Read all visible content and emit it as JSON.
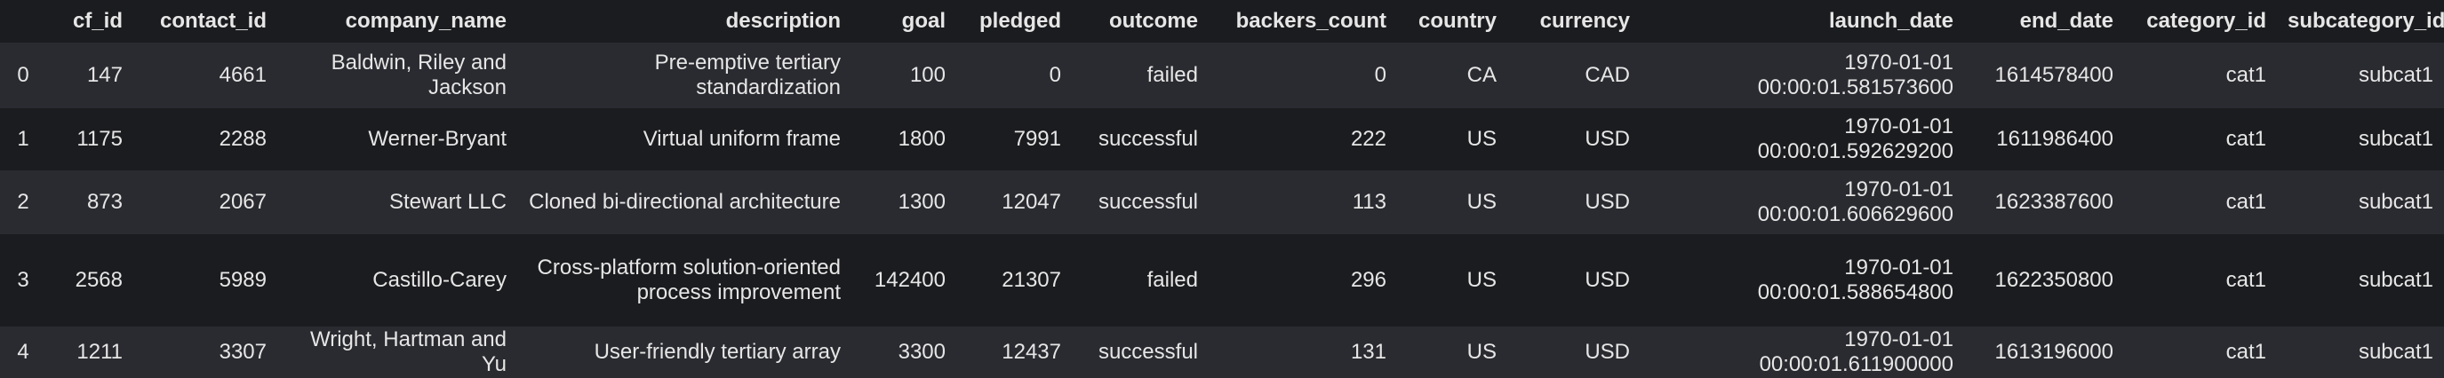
{
  "columns": [
    "",
    "cf_id",
    "contact_id",
    "company_name",
    "description",
    "goal",
    "pledged",
    "outcome",
    "backers_count",
    "country",
    "currency",
    "launch_date",
    "end_date",
    "category_id",
    "subcategory_id"
  ],
  "rows": [
    [
      "0",
      "147",
      "4661",
      "Baldwin, Riley and Jackson",
      "Pre-emptive tertiary standardization",
      "100",
      "0",
      "failed",
      "0",
      "CA",
      "CAD",
      "1970-01-01 00:00:01.581573600",
      "1614578400",
      "cat1",
      "subcat1"
    ],
    [
      "1",
      "1175",
      "2288",
      "Werner-Bryant",
      "Virtual uniform frame",
      "1800",
      "7991",
      "successful",
      "222",
      "US",
      "USD",
      "1970-01-01 00:00:01.592629200",
      "1611986400",
      "cat1",
      "subcat1"
    ],
    [
      "2",
      "873",
      "2067",
      "Stewart LLC",
      "Cloned bi-directional architecture",
      "1300",
      "12047",
      "successful",
      "113",
      "US",
      "USD",
      "1970-01-01 00:00:01.606629600",
      "1623387600",
      "cat1",
      "subcat1"
    ],
    [
      "3",
      "2568",
      "5989",
      "Castillo-Carey",
      "Cross-platform solution-oriented process improvement",
      "142400",
      "21307",
      "failed",
      "296",
      "US",
      "USD",
      "1970-01-01 00:00:01.588654800",
      "1622350800",
      "cat1",
      "subcat1"
    ],
    [
      "4",
      "1211",
      "3307",
      "Wright, Hartman and Yu",
      "User-friendly tertiary array",
      "3300",
      "12437",
      "successful",
      "131",
      "US",
      "USD",
      "1970-01-01 00:00:01.611900000",
      "1613196000",
      "cat1",
      "subcat1"
    ]
  ]
}
